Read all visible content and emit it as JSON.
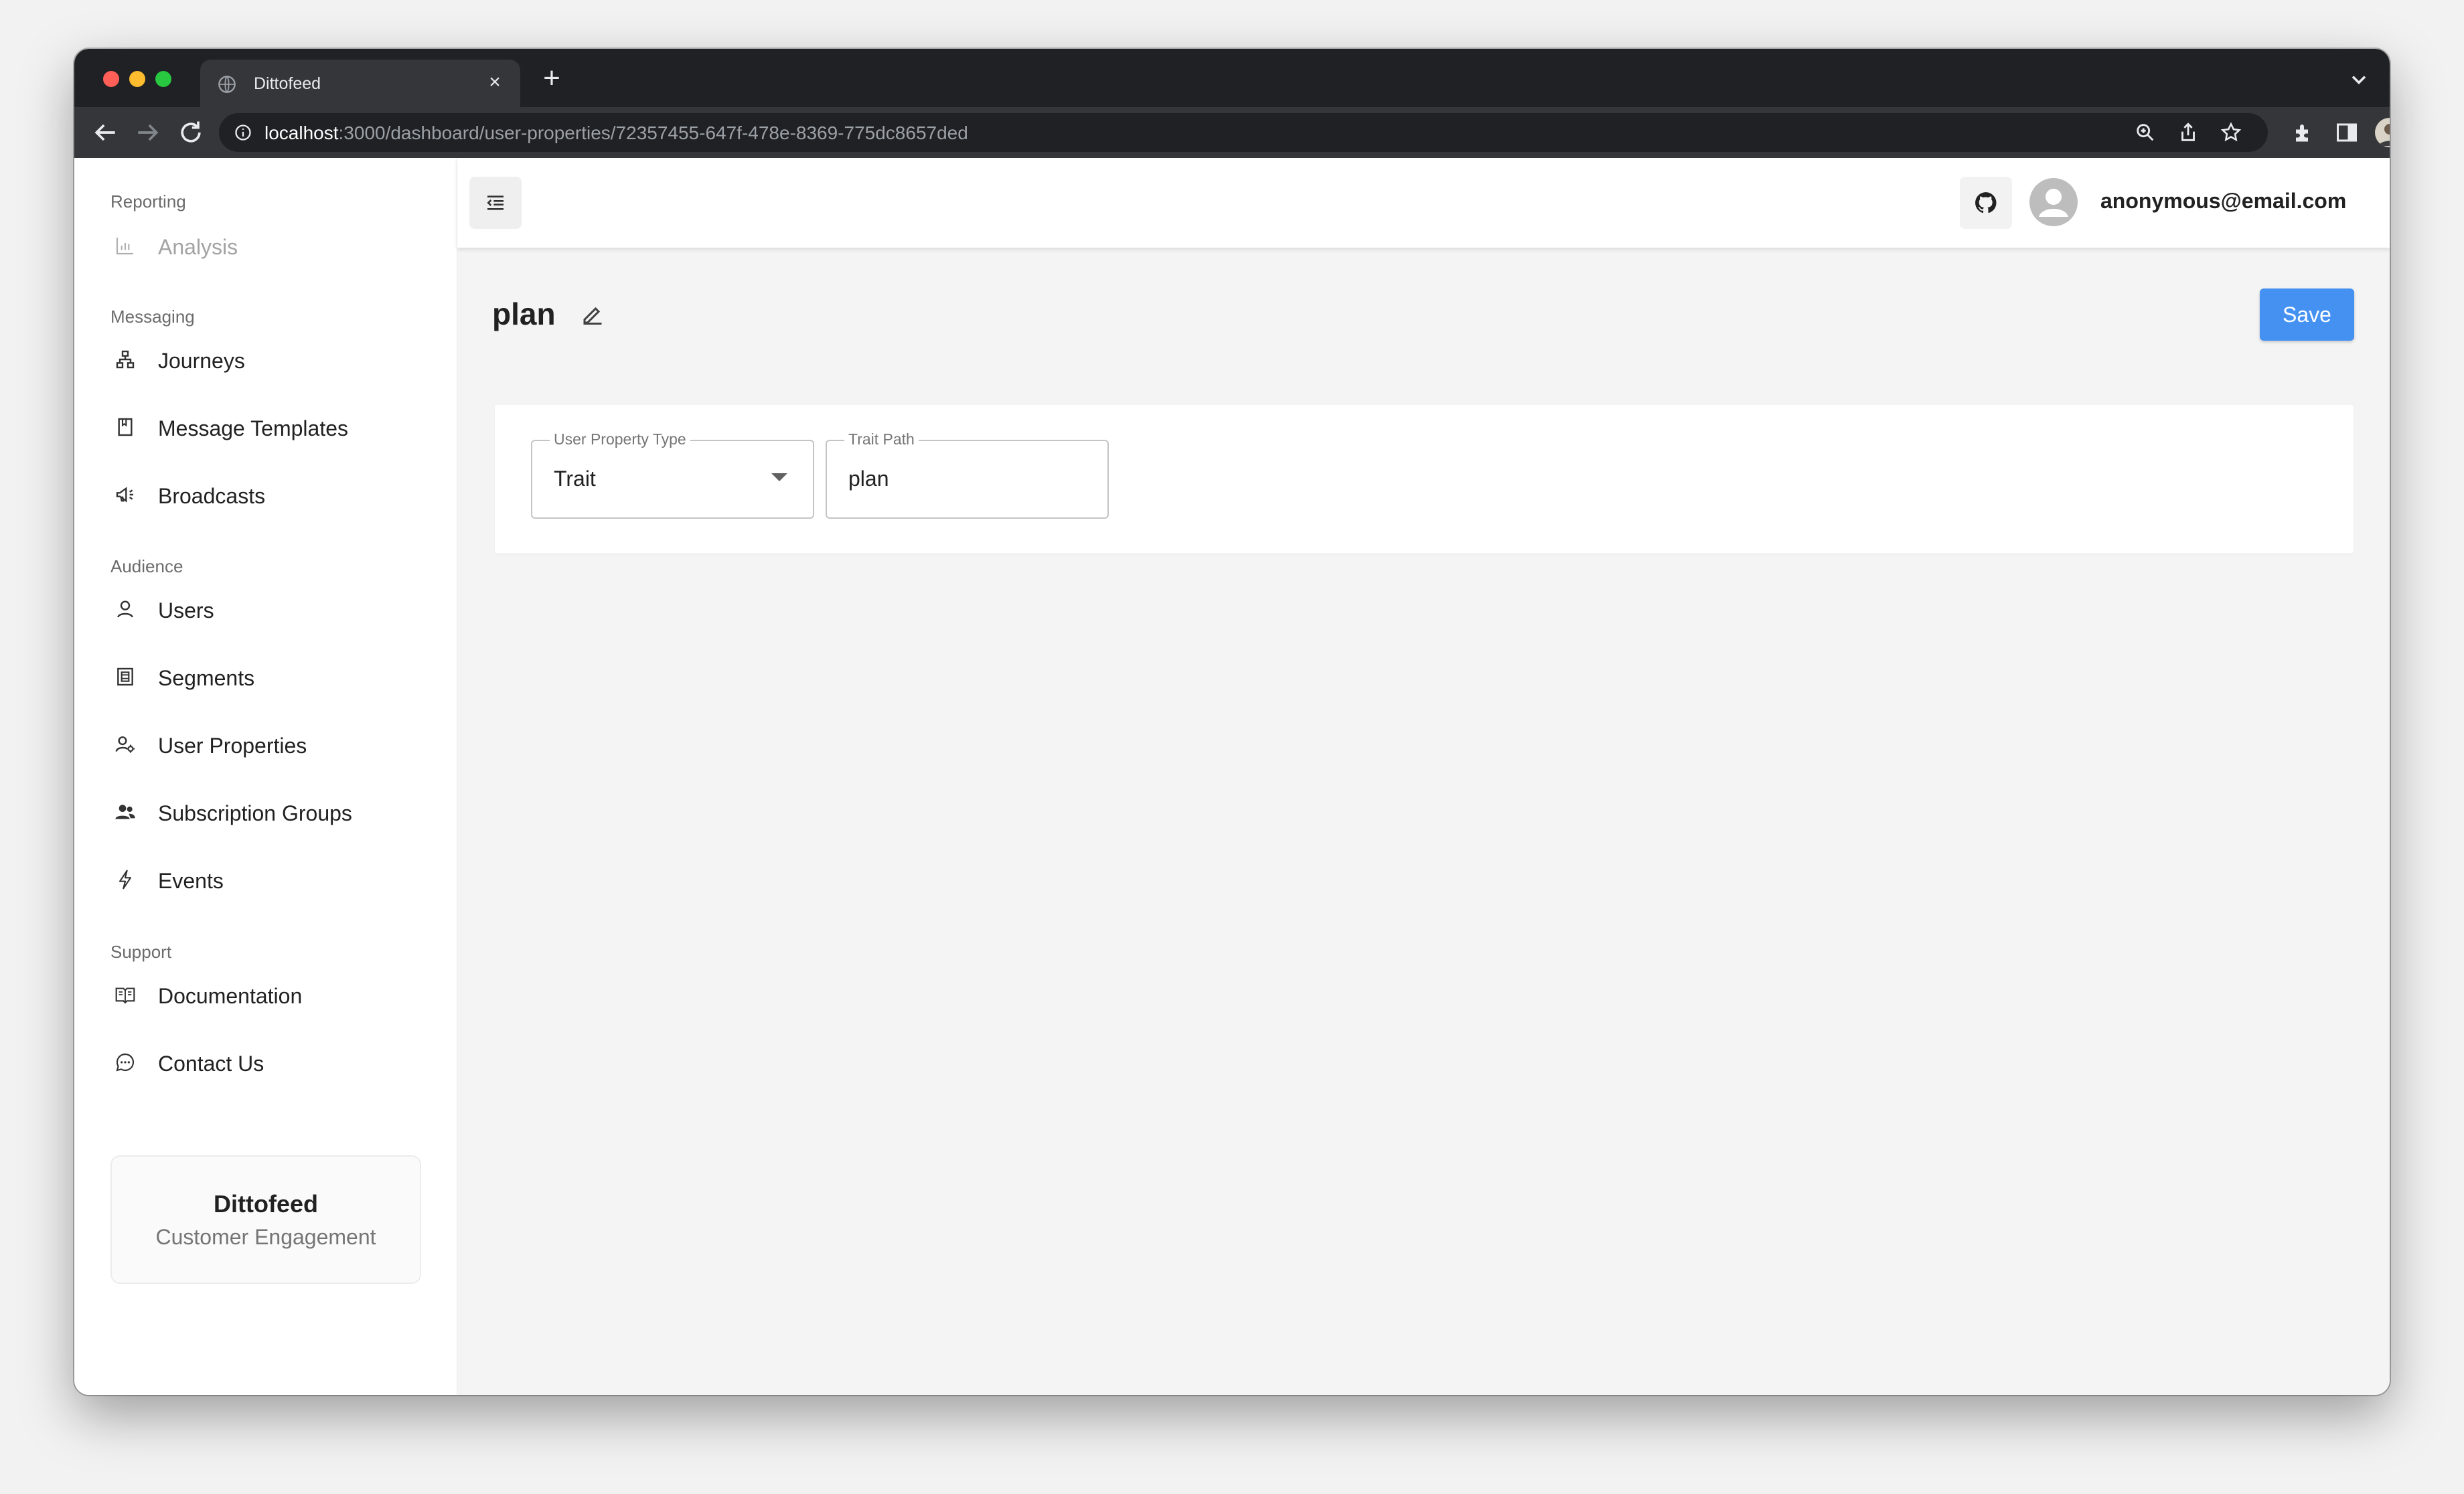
{
  "browser": {
    "tab_title": "Dittofeed",
    "url_host": "localhost",
    "url_path": ":3000/dashboard/user-properties/72357455-647f-478e-8369-775dc8657ded"
  },
  "sidebar": {
    "sections": [
      {
        "label": "Reporting",
        "items": [
          {
            "label": "Analysis",
            "icon": "chart-icon",
            "disabled": true
          }
        ]
      },
      {
        "label": "Messaging",
        "items": [
          {
            "label": "Journeys",
            "icon": "journeys-icon"
          },
          {
            "label": "Message Templates",
            "icon": "template-icon"
          },
          {
            "label": "Broadcasts",
            "icon": "megaphone-icon"
          }
        ]
      },
      {
        "label": "Audience",
        "items": [
          {
            "label": "Users",
            "icon": "user-icon"
          },
          {
            "label": "Segments",
            "icon": "segments-icon"
          },
          {
            "label": "User Properties",
            "icon": "user-gear-icon"
          },
          {
            "label": "Subscription Groups",
            "icon": "group-icon"
          },
          {
            "label": "Events",
            "icon": "lightning-icon"
          }
        ]
      },
      {
        "label": "Support",
        "items": [
          {
            "label": "Documentation",
            "icon": "book-icon"
          },
          {
            "label": "Contact Us",
            "icon": "chat-icon"
          }
        ]
      }
    ],
    "brand": {
      "name": "Dittofeed",
      "tagline": "Customer Engagement"
    }
  },
  "header": {
    "user_email": "anonymous@email.com"
  },
  "page": {
    "title": "plan",
    "save_label": "Save",
    "fields": {
      "property_type": {
        "label": "User Property Type",
        "value": "Trait"
      },
      "trait_path": {
        "label": "Trait Path",
        "value": "plan"
      }
    }
  },
  "colors": {
    "primary": "#4491f2",
    "chrome_dark": "#202124",
    "chrome_toolbar": "#35363a"
  }
}
